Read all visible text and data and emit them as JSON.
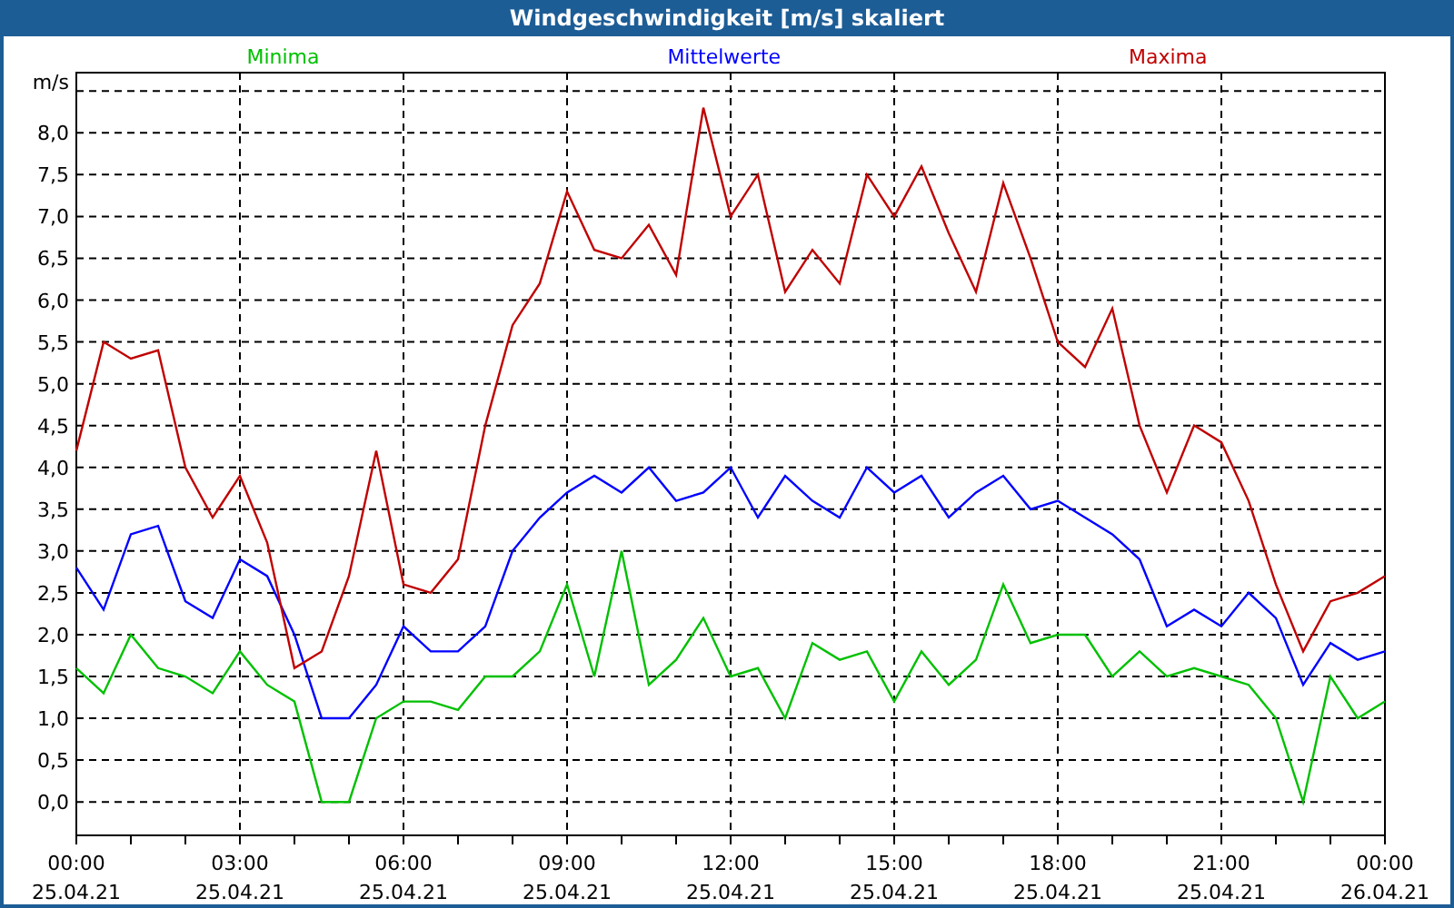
{
  "window": {
    "title": "Windgeschwindigkeit [m/s] skaliert"
  },
  "chart": {
    "chart_data": {
      "type": "line",
      "ylabel": "m/s",
      "grid": true,
      "categories": [
        "00:00 25.04.21",
        null,
        null,
        null,
        null,
        null,
        "03:00 25.04.21",
        null,
        null,
        null,
        null,
        null,
        "06:00 25.04.21",
        null,
        null,
        null,
        null,
        null,
        "09:00 25.04.21",
        null,
        null,
        null,
        null,
        null,
        "12:00 25.04.21",
        null,
        null,
        null,
        null,
        null,
        "15:00 25.04.21",
        null,
        null,
        null,
        null,
        null,
        "18:00 25.04.21",
        null,
        null,
        null,
        null,
        null,
        "21:00 25.04.21",
        null,
        null,
        null,
        null,
        null,
        "00:00 26.04.21"
      ],
      "series": [
        {
          "name": "Minima",
          "color": "#00c000",
          "values": [
            1.6,
            1.3,
            2.0,
            1.6,
            1.5,
            1.3,
            1.8,
            1.4,
            1.2,
            0.0,
            0.0,
            1.0,
            1.2,
            1.2,
            1.1,
            1.5,
            1.5,
            1.8,
            2.6,
            1.5,
            3.0,
            1.4,
            1.7,
            2.2,
            1.5,
            1.6,
            1.0,
            1.9,
            1.7,
            1.8,
            1.2,
            1.8,
            1.4,
            1.7,
            2.6,
            1.9,
            2.0,
            2.0,
            1.5,
            1.8,
            1.5,
            1.6,
            1.5,
            1.4,
            1.0,
            0.0,
            1.5,
            1.0,
            1.2
          ]
        },
        {
          "name": "Mittelwerte",
          "color": "#0000ff",
          "values": [
            2.8,
            2.3,
            3.2,
            3.3,
            2.4,
            2.2,
            2.9,
            2.7,
            2.0,
            1.0,
            1.0,
            1.4,
            2.1,
            1.8,
            1.8,
            2.1,
            3.0,
            3.4,
            3.7,
            3.9,
            3.7,
            4.0,
            3.6,
            3.7,
            4.0,
            3.4,
            3.9,
            3.6,
            3.4,
            4.0,
            3.7,
            3.9,
            3.4,
            3.7,
            3.9,
            3.5,
            3.6,
            3.4,
            3.2,
            2.9,
            2.1,
            2.3,
            2.1,
            2.5,
            2.2,
            1.4,
            1.9,
            1.7,
            1.8
          ]
        },
        {
          "name": "Maxima",
          "color": "#c00000",
          "values": [
            4.2,
            5.5,
            5.3,
            5.4,
            4.0,
            3.4,
            3.9,
            3.1,
            1.6,
            1.8,
            2.7,
            4.2,
            2.6,
            2.5,
            2.9,
            4.5,
            5.7,
            6.2,
            7.3,
            6.6,
            6.5,
            6.9,
            6.3,
            8.3,
            7.0,
            7.5,
            6.1,
            6.6,
            6.2,
            7.5,
            7.0,
            7.6,
            6.8,
            6.1,
            7.4,
            6.5,
            5.5,
            5.2,
            5.9,
            4.5,
            3.7,
            4.5,
            4.3,
            3.6,
            2.6,
            1.8,
            2.4,
            2.5,
            2.7
          ]
        }
      ],
      "ylim": [
        -0.4,
        8.72
      ],
      "yticks": [
        {
          "value": 0,
          "label": "0,0"
        },
        {
          "value": 0.5,
          "label": "0,5"
        },
        {
          "value": 1,
          "label": "1,0"
        },
        {
          "value": 1.5,
          "label": "1,5"
        },
        {
          "value": 2,
          "label": "2,0"
        },
        {
          "value": 2.5,
          "label": "2,5"
        },
        {
          "value": 3,
          "label": "3,0"
        },
        {
          "value": 3.5,
          "label": "3,5"
        },
        {
          "value": 4,
          "label": "4,0"
        },
        {
          "value": 4.5,
          "label": "4,5"
        },
        {
          "value": 5,
          "label": "5,0"
        },
        {
          "value": 5.5,
          "label": "5,5"
        },
        {
          "value": 6,
          "label": "6,0"
        },
        {
          "value": 6.5,
          "label": "6,5"
        },
        {
          "value": 7,
          "label": "7,0"
        },
        {
          "value": 7.5,
          "label": "7,5"
        },
        {
          "value": 8,
          "label": "8,0"
        }
      ]
    }
  }
}
